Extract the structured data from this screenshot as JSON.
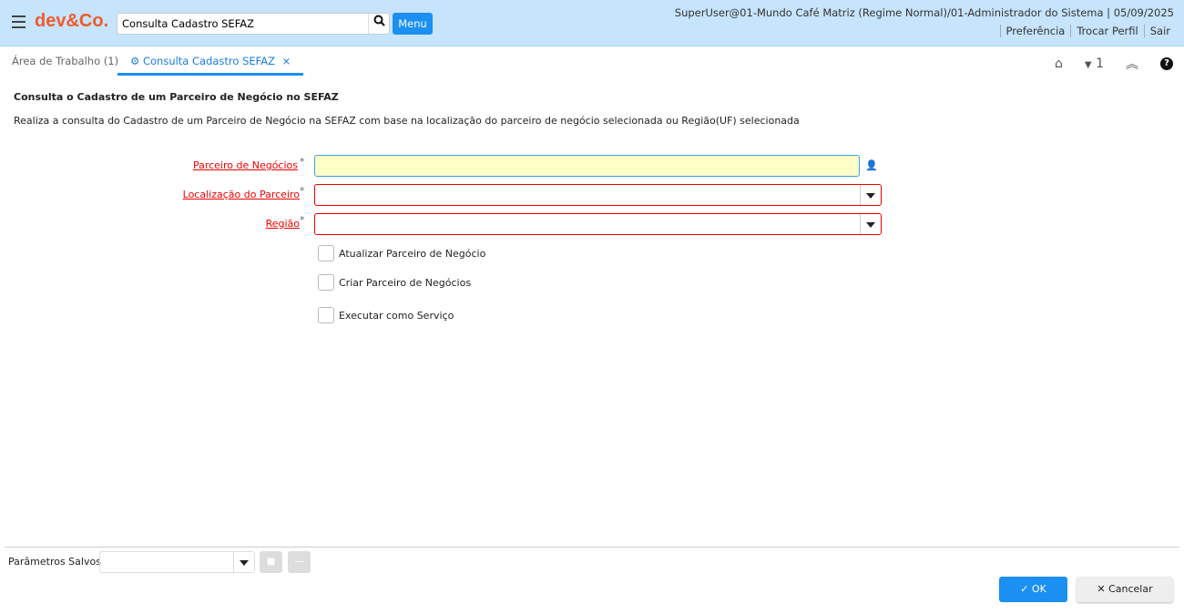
{
  "header": {
    "logo": "dev&Co.",
    "search_value": "Consulta Cadastro SEFAZ",
    "menu_label": "Menu",
    "user_info": "SuperUser@01-Mundo Café Matriz (Regime Normal)/01-Administrador do Sistema | 05/09/2025",
    "links": [
      "Preferência",
      "Trocar Perfil",
      "Sair"
    ]
  },
  "tabs": {
    "workspace": "Área de Trabalho (1)",
    "active": "Consulta Cadastro SEFAZ",
    "close": "×",
    "window_count": "1"
  },
  "page": {
    "title": "Consulta o Cadastro de um Parceiro de Negócio no SEFAZ",
    "description": "Realiza a consulta do Cadastro de um Parceiro de Negócio na SEFAZ com base na localização do parceiro de negócio selecionada ou Região(UF) selecionada"
  },
  "form": {
    "fields": [
      {
        "label": "Parceiro de Negócios",
        "value": ""
      },
      {
        "label": "Localização do Parceiro",
        "value": ""
      },
      {
        "label": "Região",
        "value": ""
      }
    ],
    "required_mark": "*",
    "checkboxes": [
      {
        "label": "Atualizar Parceiro de Negócio",
        "checked": false
      },
      {
        "label": "Criar Parceiro de Negócios",
        "checked": false
      },
      {
        "label": "Executar como Serviço",
        "checked": false
      }
    ]
  },
  "footer": {
    "saved_params_label": "Parâmetros Salvos",
    "saved_params_value": "",
    "ok": "OK",
    "cancel": "Cancelar"
  }
}
